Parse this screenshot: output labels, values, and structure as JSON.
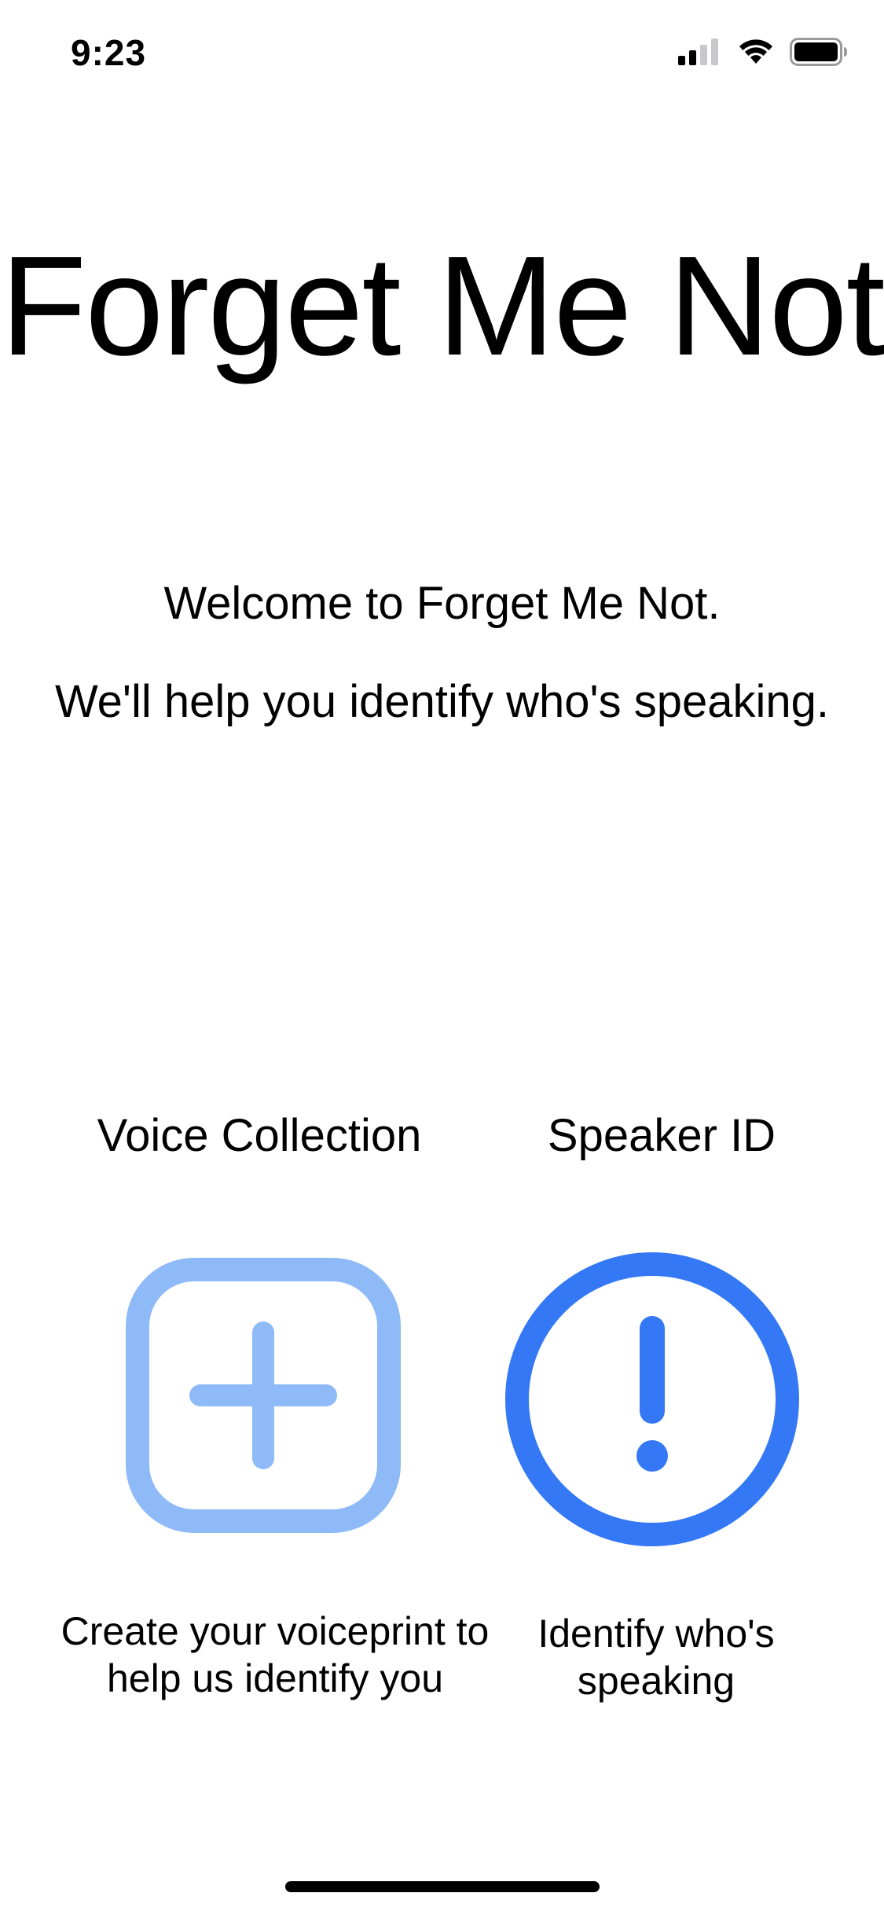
{
  "status_bar": {
    "time": "9:23",
    "signal_icon": "cellular-signal-icon",
    "wifi_icon": "wifi-icon",
    "battery_icon": "battery-icon"
  },
  "main": {
    "title": "Forget Me Not",
    "welcome_line_1": "Welcome to Forget Me Not.",
    "welcome_line_2": "We'll help you identify who's speaking."
  },
  "voice_collection": {
    "label": "Voice Collection",
    "icon": "plus-square-icon",
    "description": "Create your voiceprint to help us identify you",
    "color": "#8FBAF8"
  },
  "speaker_id": {
    "label": "Speaker ID",
    "icon": "exclamation-circle-icon",
    "description": "Identify who's speaking",
    "color": "#3478F6"
  }
}
